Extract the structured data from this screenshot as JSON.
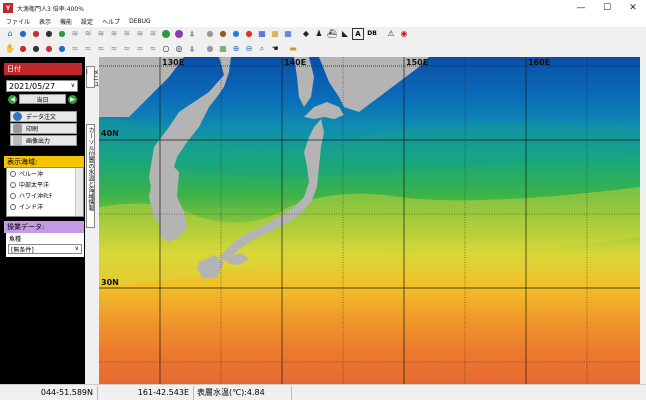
{
  "window": {
    "title": "大漁衛門人3 倍率:400%",
    "app_icon": "Y",
    "minimize": "—",
    "maximize": "☐",
    "close": "✕"
  },
  "menu": [
    "ファイル",
    "表示",
    "機能",
    "設定",
    "ヘルプ",
    "DEBUG"
  ],
  "toolbar": {
    "row1_icons": [
      "home-icon",
      "drop-blue-icon",
      "drop-red-icon",
      "drop-dark-icon",
      "drop-green-icon",
      "fish-school-icon",
      "fish-school-icon",
      "fish-school-icon",
      "fish-school-icon",
      "fish-school-icon",
      "fish-school-icon",
      "fish-school-icon",
      "dot-green-icon",
      "dot-purple-icon",
      "compass-icon",
      "drop-gray-icon",
      "drop-gray-icon",
      "drop-brown-icon",
      "drop-blue2-icon",
      "drop-red2-icon",
      "grid-blue-icon",
      "grid-yellow-icon",
      "grid-map-icon",
      "fish-icon",
      "buoy-icon",
      "ship-icon",
      "dolphin-icon",
      "text-icon",
      "db-icon",
      "warning-icon",
      "satellite-icon"
    ],
    "row2_icons": [
      "hand-icon",
      "drop-red-icon",
      "drop-dark-icon",
      "drop-red3-icon",
      "drop-blue-icon",
      "wave-icon",
      "wave-icon",
      "wave-icon",
      "wave-icon",
      "wave-icon",
      "wave-icon",
      "wave-icon",
      "circle-icon",
      "circle-double-icon",
      "compass2-icon",
      "drop-gray-icon",
      "grid-green-icon",
      "zoom-in-icon",
      "zoom-out-icon",
      "search-icon",
      "pan-hand-icon",
      "ruler-icon"
    ],
    "text_label": "A",
    "db_label": "DB"
  },
  "panel": {
    "date_head": "日付",
    "date_value": "2021/05/27",
    "prev": "◀",
    "next": "▶",
    "today": "当日",
    "data_order": "データ注文",
    "print": "印刷",
    "image_output": "画像出力",
    "region_head": "表示海域:",
    "regions": [
      "ペルー沖",
      "中部太平洋",
      "ハワイ沖ﾀﾋﾁ",
      "インド洋"
    ],
    "search_head": "操業データ:",
    "fish_label": "魚種",
    "fish_value": "[無条件]",
    "vtab_menu": "メニュー",
    "vtab_info": "カーソル位置の水温と海域情報"
  },
  "map": {
    "lon_labels": [
      "130E",
      "140E",
      "150E",
      "160E"
    ],
    "lat_labels": [
      "40N",
      "30N"
    ]
  },
  "status": {
    "lat": "044-51.589N",
    "lon": "161-42.543E",
    "temp_label": "表層水温(℃):4.84"
  },
  "colors": {
    "panel_bg": "#000000",
    "date_head": "#c0282d",
    "region_head": "#f5c400",
    "search_head": "#c59ae6",
    "land": "#b4b4b4",
    "btn_green": "#2f9f3c"
  }
}
